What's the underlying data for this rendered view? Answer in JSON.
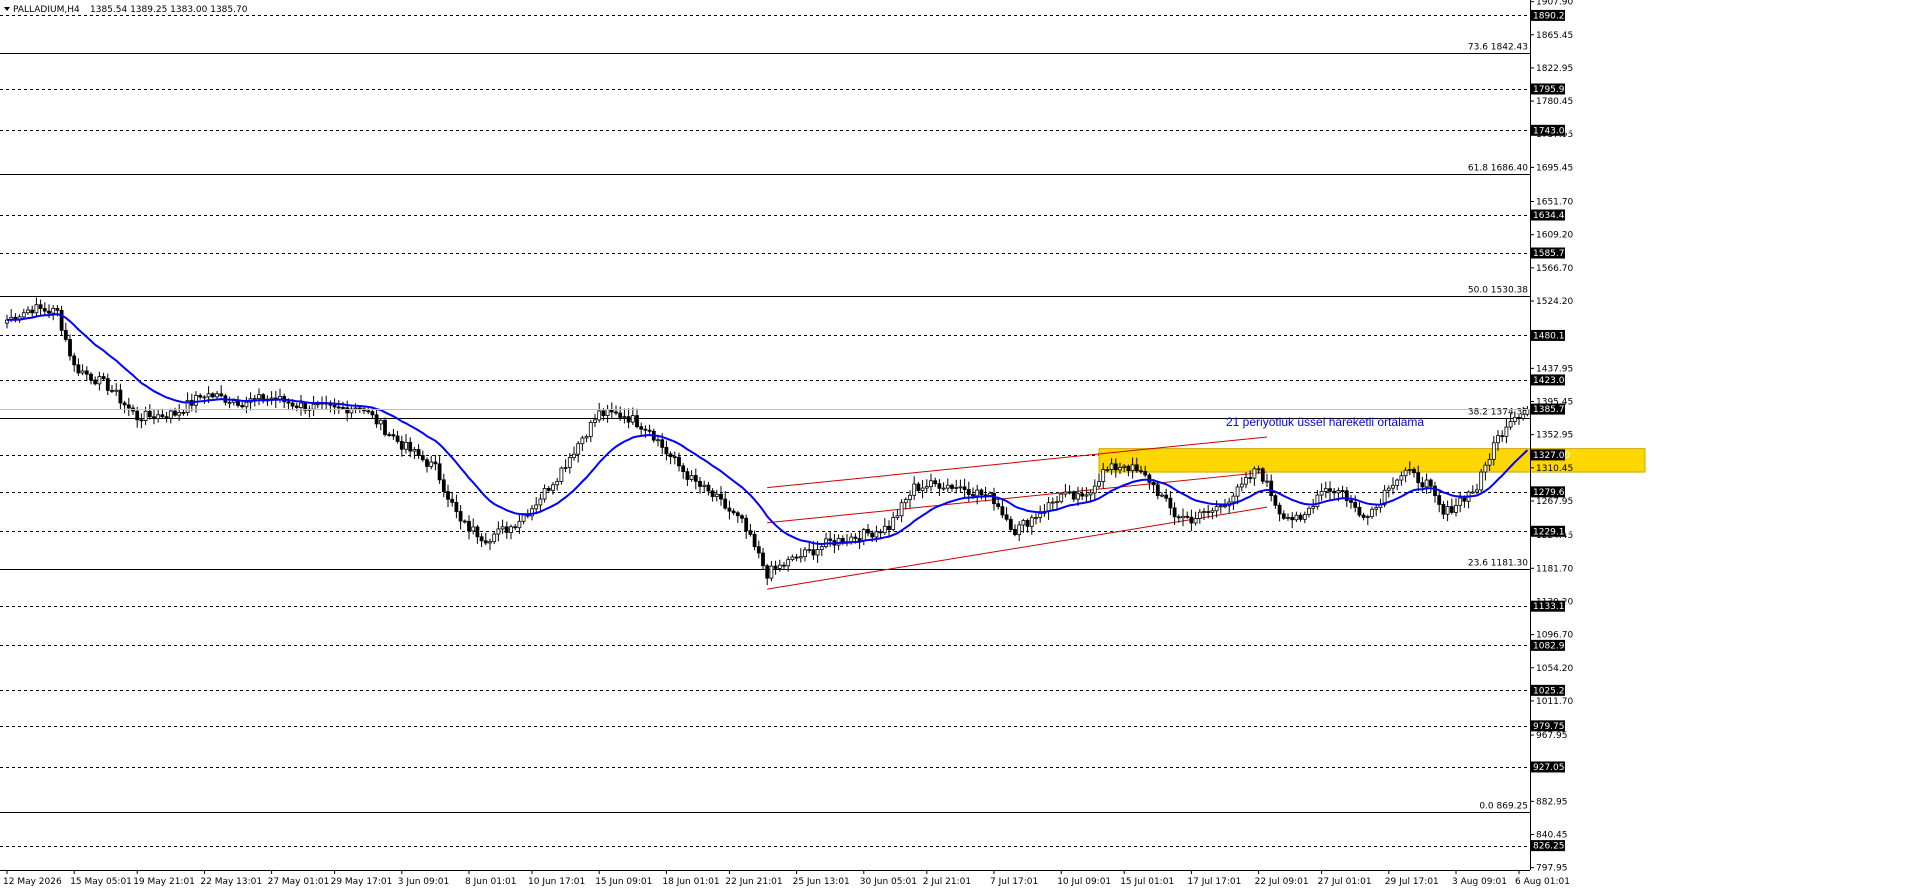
{
  "header": {
    "symbol": "PALLADIUM,H4",
    "ohlc": "1385.54 1389.25 1383.00 1385.70"
  },
  "colors": {
    "up_candle": "#000000",
    "down_candle": "#000000",
    "ema": "#0000ff",
    "channel": "#cc0000",
    "zone": "#ffd700",
    "annotation": "#0000ff",
    "grid": "#000000"
  },
  "chart_data": {
    "type": "candlestick",
    "ylim": [
      795,
      1910
    ],
    "y_ticks": [
      "1907.90",
      "1865.45",
      "1822.95",
      "1780.45",
      "1737.95",
      "1695.45",
      "1651.70",
      "1609.20",
      "1566.70",
      "1524.20",
      "1437.95",
      "1395.45",
      "1352.95",
      "1310.45",
      "1267.95",
      "1224.45",
      "1181.70",
      "1139.20",
      "1096.70",
      "1054.20",
      "1011.70",
      "967.95",
      "882.95",
      "840.45",
      "797.95"
    ],
    "current_price": {
      "value": 1385.7,
      "label": "1385.70"
    },
    "levels": [
      {
        "value": 1890.25,
        "label": "1890.25"
      },
      {
        "value": 1795.95,
        "label": "1795.95"
      },
      {
        "value": 1743.0,
        "label": "1743.00"
      },
      {
        "value": 1634.45,
        "label": "1634.45"
      },
      {
        "value": 1585.75,
        "label": "1585.75"
      },
      {
        "value": 1480.1,
        "label": "1480.10"
      },
      {
        "value": 1423.05,
        "label": "1423.05"
      },
      {
        "value": 1327.0,
        "label": "1327.00"
      },
      {
        "value": 1279.65,
        "label": "1279.65"
      },
      {
        "value": 1229.1,
        "label": "1229.10"
      },
      {
        "value": 1133.1,
        "label": "1133.10"
      },
      {
        "value": 1082.9,
        "label": "1082.90"
      },
      {
        "value": 1025.25,
        "label": "1025.25"
      },
      {
        "value": 979.75,
        "label": "979.75"
      },
      {
        "value": 927.05,
        "label": "927.05"
      },
      {
        "value": 826.25,
        "label": "826.25"
      }
    ],
    "fibonacci": [
      {
        "value": 1842.43,
        "label": "73.6 1842.43"
      },
      {
        "value": 1686.4,
        "label": "61.8 1686.40"
      },
      {
        "value": 1530.38,
        "label": "50.0 1530.38"
      },
      {
        "value": 1374.35,
        "label": "38.2 1374.35"
      },
      {
        "value": 1181.3,
        "label": "23.6 1181.30"
      },
      {
        "value": 869.25,
        "label": "0.0 869.25"
      }
    ],
    "x_labels": [
      "12 May 2026",
      "15 May 05:01",
      "19 May 21:01",
      "22 May 13:01",
      "27 May 01:01",
      "29 May 17:01",
      "3 Jun 09:01",
      "8 Jun 01:01",
      "10 Jun 17:01",
      "15 Jun 09:01",
      "18 Jun 01:01",
      "22 Jun 21:01",
      "25 Jun 13:01",
      "30 Jun 05:01",
      "2 Jul 21:01",
      "7 Jul 17:01",
      "10 Jul 09:01",
      "15 Jul 01:01",
      "17 Jul 17:01",
      "22 Jul 09:01",
      "27 Jul 01:01",
      "29 Jul 17:01",
      "3 Aug 09:01",
      "6 Aug 01:01"
    ],
    "x_label_bars": [
      0,
      16,
      31,
      47,
      63,
      78,
      94,
      110,
      125,
      141,
      157,
      172,
      188,
      204,
      219,
      235,
      251,
      266,
      282,
      298,
      313,
      329,
      345,
      360
    ],
    "price_path": [
      [
        0,
        1500
      ],
      [
        6,
        1515
      ],
      [
        12,
        1510
      ],
      [
        16,
        1440
      ],
      [
        24,
        1415
      ],
      [
        31,
        1375
      ],
      [
        40,
        1380
      ],
      [
        47,
        1405
      ],
      [
        56,
        1395
      ],
      [
        63,
        1400
      ],
      [
        70,
        1390
      ],
      [
        78,
        1385
      ],
      [
        84,
        1390
      ],
      [
        94,
        1340
      ],
      [
        102,
        1310
      ],
      [
        108,
        1240
      ],
      [
        114,
        1220
      ],
      [
        120,
        1235
      ],
      [
        125,
        1260
      ],
      [
        131,
        1300
      ],
      [
        137,
        1350
      ],
      [
        141,
        1380
      ],
      [
        147,
        1378
      ],
      [
        153,
        1360
      ],
      [
        157,
        1330
      ],
      [
        163,
        1295
      ],
      [
        169,
        1270
      ],
      [
        175,
        1240
      ],
      [
        181,
        1175
      ],
      [
        188,
        1195
      ],
      [
        196,
        1215
      ],
      [
        204,
        1225
      ],
      [
        210,
        1235
      ],
      [
        216,
        1285
      ],
      [
        222,
        1290
      ],
      [
        228,
        1285
      ],
      [
        235,
        1270
      ],
      [
        240,
        1230
      ],
      [
        245,
        1250
      ],
      [
        251,
        1275
      ],
      [
        256,
        1270
      ],
      [
        261,
        1305
      ],
      [
        266,
        1315
      ],
      [
        272,
        1295
      ],
      [
        278,
        1250
      ],
      [
        282,
        1245
      ],
      [
        287,
        1255
      ],
      [
        293,
        1280
      ],
      [
        298,
        1310
      ],
      [
        303,
        1255
      ],
      [
        308,
        1240
      ],
      [
        313,
        1285
      ],
      [
        318,
        1280
      ],
      [
        322,
        1250
      ],
      [
        326,
        1260
      ],
      [
        329,
        1290
      ],
      [
        333,
        1305
      ],
      [
        338,
        1290
      ],
      [
        342,
        1250
      ],
      [
        346,
        1270
      ],
      [
        350,
        1285
      ],
      [
        354,
        1340
      ],
      [
        358,
        1375
      ],
      [
        362,
        1385
      ]
    ],
    "ema": {
      "label": "21 periyotluk üssel hareketli ortalama",
      "period": 21
    },
    "channel": {
      "upper": [
        [
          181,
          1285
        ],
        [
          300,
          1350
        ]
      ],
      "mid": [
        [
          181,
          1240
        ],
        [
          300,
          1305
        ]
      ],
      "lower": [
        [
          181,
          1155
        ],
        [
          300,
          1260
        ]
      ]
    },
    "zone": {
      "bars": [
        260,
        390
      ],
      "low": 1305,
      "high": 1335
    }
  }
}
